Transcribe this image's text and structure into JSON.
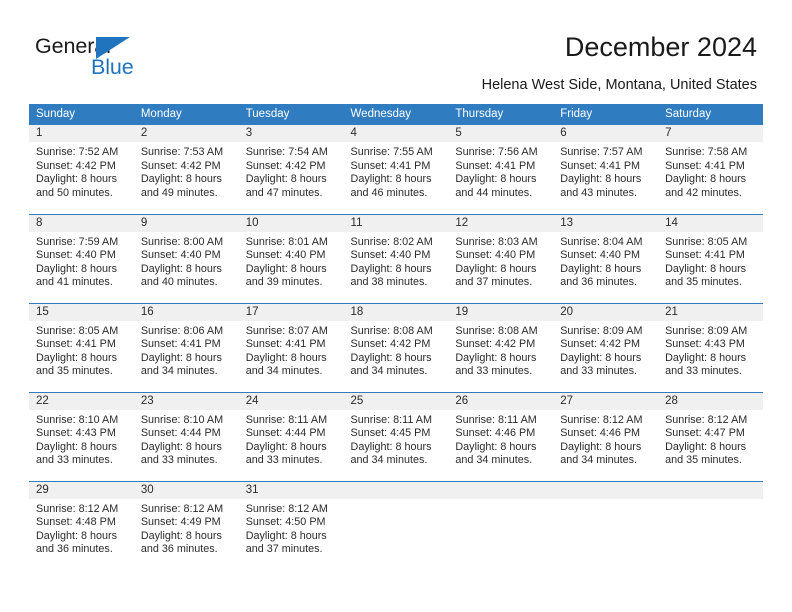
{
  "brand": {
    "name_part1": "General",
    "name_part2": "Blue",
    "accent_color": "#1f74bd",
    "flag_icon": "triangle-flag-icon"
  },
  "header": {
    "title": "December 2024",
    "subtitle": "Helena West Side, Montana, United States"
  },
  "theme": {
    "header_row_bg": "#2f7cc0",
    "daynum_band_bg": "#f0f0f0",
    "grid_line": "#2f7cc0",
    "text": "#2b2b2b"
  },
  "calendar": {
    "weekday_headers": [
      "Sunday",
      "Monday",
      "Tuesday",
      "Wednesday",
      "Thursday",
      "Friday",
      "Saturday"
    ],
    "weeks": [
      [
        {
          "day": "1",
          "lines": [
            "Sunrise: 7:52 AM",
            "Sunset: 4:42 PM",
            "Daylight: 8 hours",
            "and 50 minutes."
          ]
        },
        {
          "day": "2",
          "lines": [
            "Sunrise: 7:53 AM",
            "Sunset: 4:42 PM",
            "Daylight: 8 hours",
            "and 49 minutes."
          ]
        },
        {
          "day": "3",
          "lines": [
            "Sunrise: 7:54 AM",
            "Sunset: 4:42 PM",
            "Daylight: 8 hours",
            "and 47 minutes."
          ]
        },
        {
          "day": "4",
          "lines": [
            "Sunrise: 7:55 AM",
            "Sunset: 4:41 PM",
            "Daylight: 8 hours",
            "and 46 minutes."
          ]
        },
        {
          "day": "5",
          "lines": [
            "Sunrise: 7:56 AM",
            "Sunset: 4:41 PM",
            "Daylight: 8 hours",
            "and 44 minutes."
          ]
        },
        {
          "day": "6",
          "lines": [
            "Sunrise: 7:57 AM",
            "Sunset: 4:41 PM",
            "Daylight: 8 hours",
            "and 43 minutes."
          ]
        },
        {
          "day": "7",
          "lines": [
            "Sunrise: 7:58 AM",
            "Sunset: 4:41 PM",
            "Daylight: 8 hours",
            "and 42 minutes."
          ]
        }
      ],
      [
        {
          "day": "8",
          "lines": [
            "Sunrise: 7:59 AM",
            "Sunset: 4:40 PM",
            "Daylight: 8 hours",
            "and 41 minutes."
          ]
        },
        {
          "day": "9",
          "lines": [
            "Sunrise: 8:00 AM",
            "Sunset: 4:40 PM",
            "Daylight: 8 hours",
            "and 40 minutes."
          ]
        },
        {
          "day": "10",
          "lines": [
            "Sunrise: 8:01 AM",
            "Sunset: 4:40 PM",
            "Daylight: 8 hours",
            "and 39 minutes."
          ]
        },
        {
          "day": "11",
          "lines": [
            "Sunrise: 8:02 AM",
            "Sunset: 4:40 PM",
            "Daylight: 8 hours",
            "and 38 minutes."
          ]
        },
        {
          "day": "12",
          "lines": [
            "Sunrise: 8:03 AM",
            "Sunset: 4:40 PM",
            "Daylight: 8 hours",
            "and 37 minutes."
          ]
        },
        {
          "day": "13",
          "lines": [
            "Sunrise: 8:04 AM",
            "Sunset: 4:40 PM",
            "Daylight: 8 hours",
            "and 36 minutes."
          ]
        },
        {
          "day": "14",
          "lines": [
            "Sunrise: 8:05 AM",
            "Sunset: 4:41 PM",
            "Daylight: 8 hours",
            "and 35 minutes."
          ]
        }
      ],
      [
        {
          "day": "15",
          "lines": [
            "Sunrise: 8:05 AM",
            "Sunset: 4:41 PM",
            "Daylight: 8 hours",
            "and 35 minutes."
          ]
        },
        {
          "day": "16",
          "lines": [
            "Sunrise: 8:06 AM",
            "Sunset: 4:41 PM",
            "Daylight: 8 hours",
            "and 34 minutes."
          ]
        },
        {
          "day": "17",
          "lines": [
            "Sunrise: 8:07 AM",
            "Sunset: 4:41 PM",
            "Daylight: 8 hours",
            "and 34 minutes."
          ]
        },
        {
          "day": "18",
          "lines": [
            "Sunrise: 8:08 AM",
            "Sunset: 4:42 PM",
            "Daylight: 8 hours",
            "and 34 minutes."
          ]
        },
        {
          "day": "19",
          "lines": [
            "Sunrise: 8:08 AM",
            "Sunset: 4:42 PM",
            "Daylight: 8 hours",
            "and 33 minutes."
          ]
        },
        {
          "day": "20",
          "lines": [
            "Sunrise: 8:09 AM",
            "Sunset: 4:42 PM",
            "Daylight: 8 hours",
            "and 33 minutes."
          ]
        },
        {
          "day": "21",
          "lines": [
            "Sunrise: 8:09 AM",
            "Sunset: 4:43 PM",
            "Daylight: 8 hours",
            "and 33 minutes."
          ]
        }
      ],
      [
        {
          "day": "22",
          "lines": [
            "Sunrise: 8:10 AM",
            "Sunset: 4:43 PM",
            "Daylight: 8 hours",
            "and 33 minutes."
          ]
        },
        {
          "day": "23",
          "lines": [
            "Sunrise: 8:10 AM",
            "Sunset: 4:44 PM",
            "Daylight: 8 hours",
            "and 33 minutes."
          ]
        },
        {
          "day": "24",
          "lines": [
            "Sunrise: 8:11 AM",
            "Sunset: 4:44 PM",
            "Daylight: 8 hours",
            "and 33 minutes."
          ]
        },
        {
          "day": "25",
          "lines": [
            "Sunrise: 8:11 AM",
            "Sunset: 4:45 PM",
            "Daylight: 8 hours",
            "and 34 minutes."
          ]
        },
        {
          "day": "26",
          "lines": [
            "Sunrise: 8:11 AM",
            "Sunset: 4:46 PM",
            "Daylight: 8 hours",
            "and 34 minutes."
          ]
        },
        {
          "day": "27",
          "lines": [
            "Sunrise: 8:12 AM",
            "Sunset: 4:46 PM",
            "Daylight: 8 hours",
            "and 34 minutes."
          ]
        },
        {
          "day": "28",
          "lines": [
            "Sunrise: 8:12 AM",
            "Sunset: 4:47 PM",
            "Daylight: 8 hours",
            "and 35 minutes."
          ]
        }
      ],
      [
        {
          "day": "29",
          "lines": [
            "Sunrise: 8:12 AM",
            "Sunset: 4:48 PM",
            "Daylight: 8 hours",
            "and 36 minutes."
          ]
        },
        {
          "day": "30",
          "lines": [
            "Sunrise: 8:12 AM",
            "Sunset: 4:49 PM",
            "Daylight: 8 hours",
            "and 36 minutes."
          ]
        },
        {
          "day": "31",
          "lines": [
            "Sunrise: 8:12 AM",
            "Sunset: 4:50 PM",
            "Daylight: 8 hours",
            "and 37 minutes."
          ]
        },
        {
          "day": "",
          "lines": []
        },
        {
          "day": "",
          "lines": []
        },
        {
          "day": "",
          "lines": []
        },
        {
          "day": "",
          "lines": []
        }
      ]
    ]
  }
}
